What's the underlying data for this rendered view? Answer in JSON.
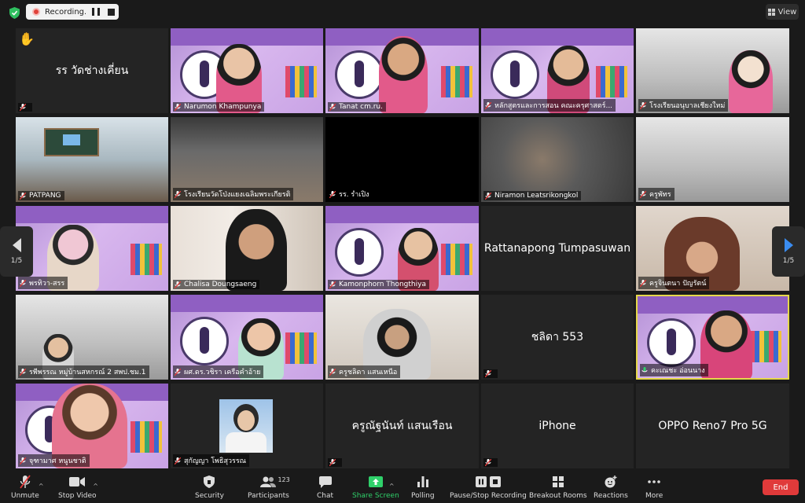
{
  "recording": {
    "label": "Recording..."
  },
  "view": {
    "label": "View"
  },
  "pager": {
    "left": "1/5",
    "right": "1/5"
  },
  "banner": {
    "line1": "สาขาวิชาการประถมศึกษา",
    "line2": "คณะครุศาสตร์ มหาวิทยาลัยราชภัฏเชียงใหม่",
    "script": "Elementary Education"
  },
  "tiles": [
    {
      "name": "รร วัดช่างเคี่ยน",
      "center": "รร วัดช่างเคี่ยน",
      "hand": "✋"
    },
    {
      "name": "Narumon Khampunya"
    },
    {
      "name": "Tanat cm.ru."
    },
    {
      "name": "หลักสูตรและการสอน คณะครุศาสตร์..."
    },
    {
      "name": "โรงเรียนอนุบาลเชียงใหม่"
    },
    {
      "name": "PATPANG"
    },
    {
      "name": "โรงเรียนวัดโป่งแยงเฉลิมพระเกียรติ"
    },
    {
      "name": "รร. รำเปิง"
    },
    {
      "name": "Niramon Leatsrikongkol"
    },
    {
      "name": "ครูพัทร"
    },
    {
      "name": "พรทิวา-สรร"
    },
    {
      "name": "Chalisa Doungsaeng"
    },
    {
      "name": "Kamonphorn Thongthiya"
    },
    {
      "name": "",
      "center": "Rattanapong Tumpasuwan"
    },
    {
      "name": "ครูจินตนา ปัญรัตน์"
    },
    {
      "name": "รพีพรรณ หมู่บ้านสหกรณ์ 2 สพป.ชม.1"
    },
    {
      "name": "ผศ.ดร.วชิรา เครือคำอ้าย"
    },
    {
      "name": "ครูชลิดา แสนเหนือ"
    },
    {
      "name": "",
      "center": "ชลิดา 553"
    },
    {
      "name": "คะเณชะ อ่อนนาง"
    },
    {
      "name": "จุฑามาศ หนูนชาติ"
    },
    {
      "name": "สุกัญญา โพธิสุวรรณ"
    },
    {
      "name": "",
      "center": "ครูณัฐนันท์ แสนเรือน"
    },
    {
      "name": "",
      "center": "iPhone"
    },
    {
      "name": "",
      "center": "OPPO Reno7 Pro 5G"
    }
  ],
  "toolbar": {
    "unmute": "Unmute",
    "stop_video": "Stop Video",
    "security": "Security",
    "participants": "Participants",
    "participants_count": "123",
    "chat": "Chat",
    "share_screen": "Share Screen",
    "polling": "Polling",
    "pause_stop_recording": "Pause/Stop Recording",
    "breakout_rooms": "Breakout Rooms",
    "reactions": "Reactions",
    "more": "More",
    "end": "End"
  },
  "colors": {
    "accent": "#2fd06a",
    "end": "#e03a3a",
    "speaking": "#e6d84a",
    "banner": "#8f5fc2"
  }
}
